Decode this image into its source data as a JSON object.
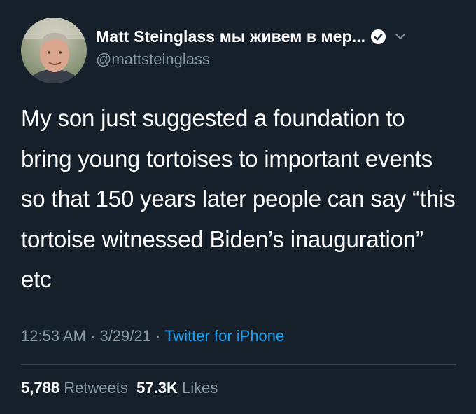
{
  "author": {
    "display_name": "Matt Steinglass мы живем в мер...",
    "handle": "@mattsteinglass",
    "verified": true,
    "avatar_icon": "profile-photo"
  },
  "tweet": {
    "text": "My son just suggested a foundation to bring young tortoises to important events so that 150 years later people can say “this tortoise witnessed Biden’s inauguration” etc"
  },
  "meta": {
    "time": "12:53 AM",
    "separator1": " · ",
    "date": "3/29/21",
    "separator2": " · ",
    "source": "Twitter for iPhone"
  },
  "stats": {
    "retweets_count": "5,788",
    "retweets_label": "Retweets",
    "likes_count": "57.3K",
    "likes_label": "Likes"
  },
  "colors": {
    "background": "#15202b",
    "text": "#ffffff",
    "secondary_text": "#8899a6",
    "link": "#1da1f2",
    "divider": "#38444d"
  }
}
